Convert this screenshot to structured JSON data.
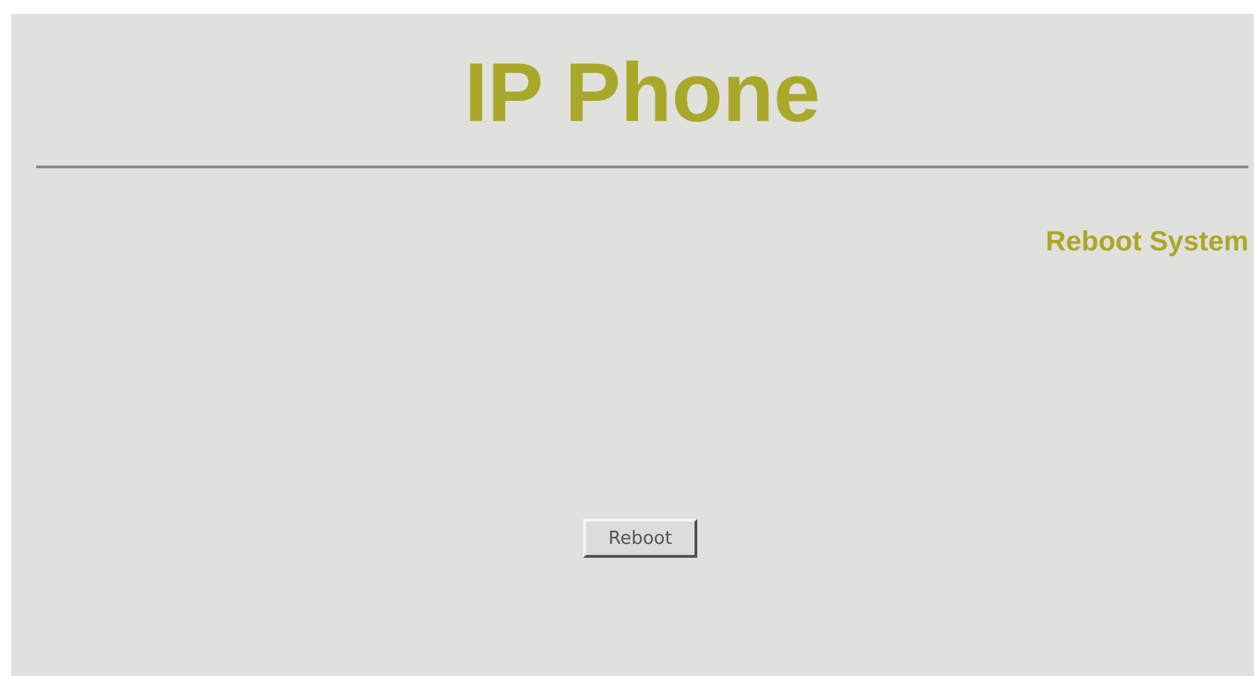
{
  "header": {
    "title": "IP Phone"
  },
  "page": {
    "heading": "Reboot System"
  },
  "buttons": [
    {
      "label": "Reboot"
    }
  ]
}
